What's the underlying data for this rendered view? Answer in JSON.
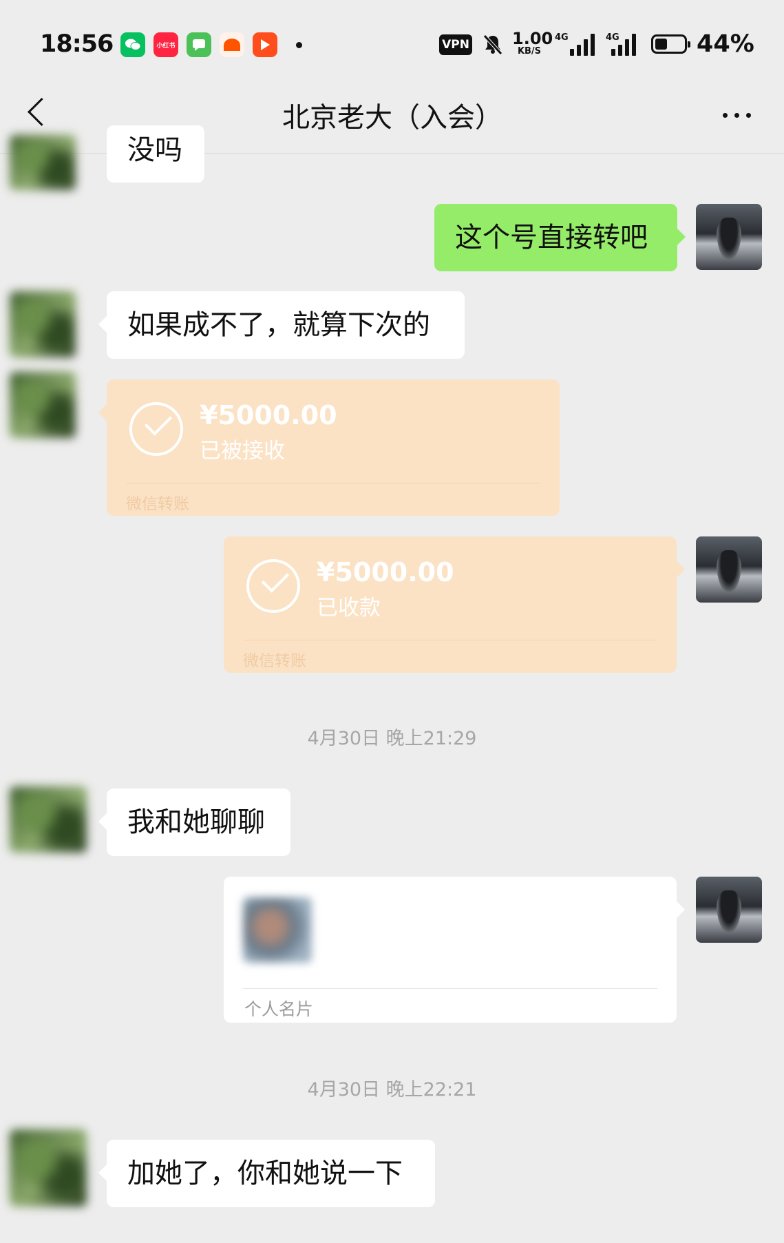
{
  "status_bar": {
    "time": "18:56",
    "apps": [
      {
        "name": "wechat-app-icon",
        "color": "#07c160",
        "text": ""
      },
      {
        "name": "xiaohongshu-app-icon",
        "color": "#ff2442",
        "text": "小红书"
      },
      {
        "name": "messages-app-icon",
        "color": "#4cc158",
        "text": ""
      },
      {
        "name": "taobao-app-icon",
        "color": "#ff5500",
        "text": ""
      },
      {
        "name": "video-app-icon",
        "color": "#ff4d1c",
        "text": ""
      }
    ],
    "vpn": "VPN",
    "speed_value": "1.00",
    "speed_unit": "KB/S",
    "network1": "4G",
    "network2": "4G",
    "battery": "44%"
  },
  "header": {
    "title": "北京老大（入会）"
  },
  "messages": {
    "partial_top": "没吗",
    "sent_1": "这个号直接转吧",
    "recv_1": "如果成不了，就算下次的",
    "transfer_recv": {
      "amount": "¥5000.00",
      "status": "已被接收",
      "label": "微信转账"
    },
    "transfer_sent": {
      "amount": "¥5000.00",
      "status": "已收款",
      "label": "微信转账"
    },
    "time_1": "4月30日 晚上21:29",
    "recv_2": "我和她聊聊",
    "card": {
      "label": "个人名片"
    },
    "time_2": "4月30日 晚上22:21",
    "recv_3": "加她了，你和她说一下"
  },
  "colors": {
    "background": "#ededed",
    "sent_bubble": "#95ec69",
    "transfer_bubble": "#fbe2c4"
  }
}
